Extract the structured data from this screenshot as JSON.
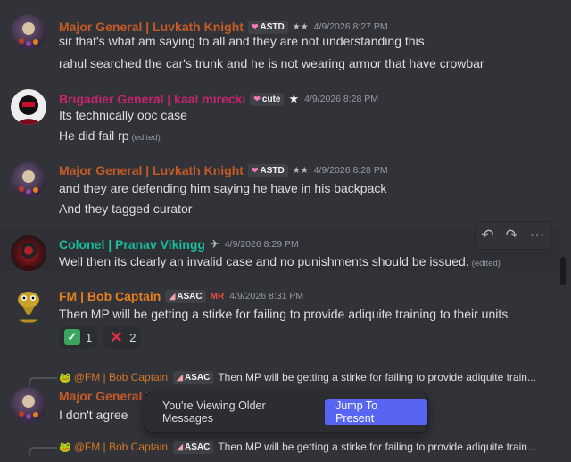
{
  "messages": [
    {
      "author": "Major General | Luvkath  Knight",
      "tag": "ASTD",
      "role_icon": "★★",
      "timestamp": "4/9/2026 8:27 PM",
      "lines": [
        "sir that's what am saying to all and they are not understanding this",
        "rahul searched the car's trunk and he is not wearing armor that have crowbar"
      ]
    },
    {
      "author": "Brigadier General | kaal mirecki",
      "tag": "cute",
      "role_icon": "★",
      "timestamp": "4/9/2026 8:28 PM",
      "lines": [
        "Its technically ooc case",
        "He did fail rp"
      ],
      "edited": "(edited)"
    },
    {
      "author": "Major General | Luvkath  Knight",
      "tag": "ASTD",
      "role_icon": "★★",
      "timestamp": "4/9/2026 8:28 PM",
      "lines": [
        "and they are defending him saying he have in his backpack",
        "And they tagged curator"
      ]
    },
    {
      "author": "Colonel | Pranav Vikingg",
      "role_icon": "✈",
      "timestamp": "4/9/2026 8:29 PM",
      "lines": [
        "Well then its clearly an invalid case and no punishments should be issued."
      ],
      "edited": "(edited)"
    },
    {
      "author": "FM | Bob Captain",
      "tag": "ASAC",
      "role_icon": "MR",
      "timestamp": "4/9/2026 8:31 PM",
      "lines": [
        "Then MP will be getting a stirke for failing to provide adiquite training to their units"
      ],
      "reactions": [
        {
          "emoji": "check-mark",
          "count": "1"
        },
        {
          "emoji": "cross-mark",
          "count": "2"
        }
      ]
    },
    {
      "reply_to": "@FM | Bob Captain",
      "reply_tag": "ASAC",
      "reply_text": "Then MP will be getting a stirke for failing to provide adiquite train...",
      "author": "Major General | Luvkath  Knight",
      "lines": [
        "I don't agree"
      ]
    },
    {
      "reply_to": "@FM | Bob Captain",
      "reply_tag": "ASAC",
      "reply_text": "Then MP will be getting a stirke for failing to provide adiquite train..."
    }
  ],
  "banner": {
    "text": "You're Viewing Older Messages",
    "button": "Jump To Present"
  },
  "colors": {
    "major": "#c55a26",
    "brigadier": "#c4256e",
    "colonel": "#1abc9c",
    "fm": "#e67e22",
    "accent": "#5865f2"
  }
}
